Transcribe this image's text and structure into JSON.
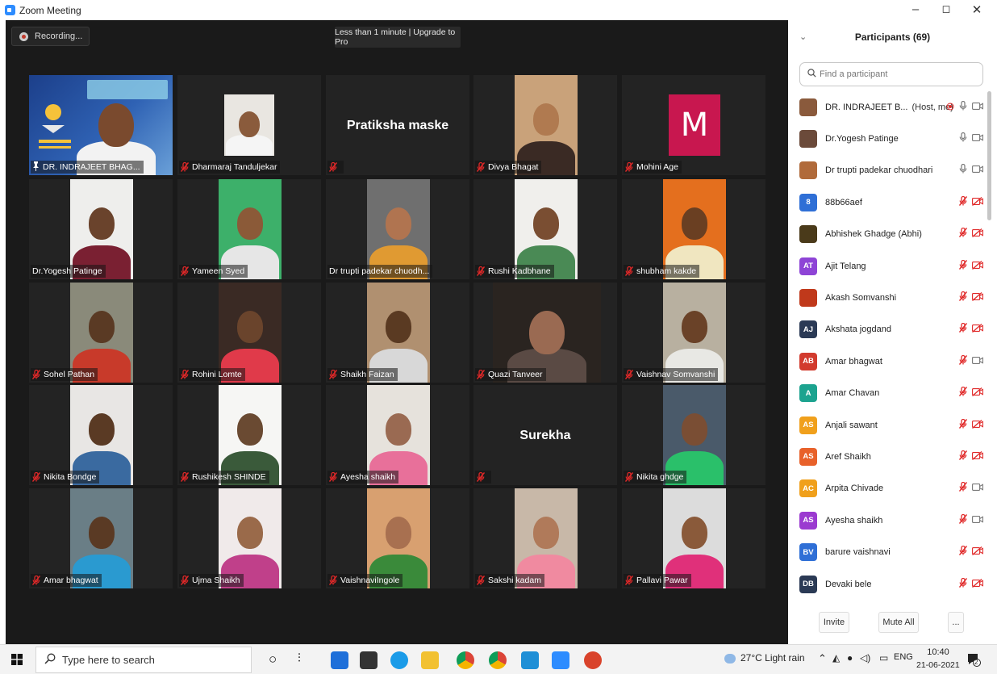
{
  "window": {
    "title": "Zoom Meeting",
    "controls": [
      "–",
      "◻",
      "✕"
    ]
  },
  "meeting": {
    "recording_label": "Recording...",
    "timer_label": "Less than 1 minute | Upgrade to Pro",
    "tiles": [
      {
        "name": "DR. INDRAJEET BHAG...",
        "kind": "video",
        "pinned": true,
        "active": true
      },
      {
        "name": "Dharmaraj Tanduljekar",
        "kind": "video",
        "muted": true
      },
      {
        "name": "",
        "kind": "text",
        "display": "Pratiksha maske",
        "muted": true
      },
      {
        "name": "Divya Bhagat",
        "kind": "video",
        "muted": true
      },
      {
        "name": "Mohini Age",
        "kind": "avatar",
        "letter": "M",
        "muted": true
      },
      {
        "name": "Dr.Yogesh Patinge",
        "kind": "video",
        "muted": false
      },
      {
        "name": "Yameen Syed",
        "kind": "video",
        "muted": true
      },
      {
        "name": "Dr trupti padekar chuodh...",
        "kind": "video",
        "muted": false
      },
      {
        "name": "Rushi Kadbhane",
        "kind": "video",
        "muted": true
      },
      {
        "name": "shubham kakde",
        "kind": "video",
        "muted": true
      },
      {
        "name": "Sohel Pathan",
        "kind": "video",
        "muted": true
      },
      {
        "name": "Rohini Lomte",
        "kind": "video",
        "muted": true
      },
      {
        "name": "Shaikh Faizan",
        "kind": "video",
        "muted": true
      },
      {
        "name": "Quazi Tanveer",
        "kind": "video",
        "muted": true
      },
      {
        "name": "Vaishnav Somvanshi",
        "kind": "video",
        "muted": true
      },
      {
        "name": "Nikita Bondge",
        "kind": "video",
        "muted": true
      },
      {
        "name": "Rushikesh SHINDE",
        "kind": "video",
        "muted": true
      },
      {
        "name": "Ayesha shaikh",
        "kind": "video",
        "muted": true
      },
      {
        "name": "",
        "kind": "text",
        "display": "Surekha",
        "muted": true
      },
      {
        "name": "Nikita ghdge",
        "kind": "video",
        "muted": true
      },
      {
        "name": "Amar bhagwat",
        "kind": "video",
        "muted": true
      },
      {
        "name": "Ujma Shaikh",
        "kind": "video",
        "muted": true
      },
      {
        "name": "VaishnaviIngole",
        "kind": "video",
        "muted": true
      },
      {
        "name": "Sakshi kadam",
        "kind": "video",
        "muted": true
      },
      {
        "name": "Pallavi Pawar",
        "kind": "video",
        "muted": true
      }
    ]
  },
  "participants": {
    "title": "Participants (69)",
    "search_placeholder": "Find a participant",
    "items": [
      {
        "initials": "",
        "name": "DR. INDRAJEET B...",
        "meta": "(Host, me)",
        "color": "#8a5a3c",
        "mic": "on",
        "video": "on",
        "rec": true
      },
      {
        "initials": "",
        "name": "Dr.Yogesh Patinge",
        "meta": "",
        "color": "#6b4a3a",
        "mic": "on",
        "video": "on"
      },
      {
        "initials": "",
        "name": "Dr trupti padekar chuodhari",
        "meta": "",
        "color": "#b06a3a",
        "mic": "on",
        "video": "on"
      },
      {
        "initials": "8",
        "name": "88b66aef",
        "meta": "",
        "color": "#2f6fd6",
        "mic": "off",
        "video": "off"
      },
      {
        "initials": "",
        "name": "Abhishek Ghadge (Abhi)",
        "meta": "",
        "color": "#4a3a1a",
        "mic": "off",
        "video": "off"
      },
      {
        "initials": "AT",
        "name": "Ajit Telang",
        "meta": "",
        "color": "#8e44d6",
        "mic": "off",
        "video": "off"
      },
      {
        "initials": "",
        "name": "Akash Somvanshi",
        "meta": "",
        "color": "#c0391b",
        "mic": "off",
        "video": "off"
      },
      {
        "initials": "AJ",
        "name": "Akshata jogdand",
        "meta": "",
        "color": "#2b3a55",
        "mic": "off",
        "video": "off"
      },
      {
        "initials": "AB",
        "name": "Amar bhagwat",
        "meta": "",
        "color": "#d23b2e",
        "mic": "off",
        "video": "on"
      },
      {
        "initials": "A",
        "name": "Amar Chavan",
        "meta": "",
        "color": "#1ca38f",
        "mic": "off",
        "video": "off"
      },
      {
        "initials": "AS",
        "name": "Anjali sawant",
        "meta": "",
        "color": "#f0a01c",
        "mic": "off",
        "video": "off"
      },
      {
        "initials": "AS",
        "name": "Aref Shaikh",
        "meta": "",
        "color": "#e8612a",
        "mic": "off",
        "video": "off"
      },
      {
        "initials": "AC",
        "name": "Arpita Chivade",
        "meta": "",
        "color": "#f0a01c",
        "mic": "off",
        "video": "on"
      },
      {
        "initials": "AS",
        "name": "Ayesha shaikh",
        "meta": "",
        "color": "#9b3ad0",
        "mic": "off",
        "video": "on"
      },
      {
        "initials": "BV",
        "name": "barure vaishnavi",
        "meta": "",
        "color": "#2f6fd6",
        "mic": "off",
        "video": "off"
      },
      {
        "initials": "DB",
        "name": "Devaki bele",
        "meta": "",
        "color": "#2b3a55",
        "mic": "off",
        "video": "off"
      }
    ],
    "invite_label": "Invite",
    "mute_all_label": "Mute All",
    "more_label": "..."
  },
  "taskbar": {
    "search_placeholder": "Type here to search",
    "weather": "27°C  Light rain",
    "lang": "ENG",
    "time": "10:40",
    "date": "21-06-2021",
    "notif_count": "2"
  },
  "colors": {
    "accent": "#2d8cff",
    "muted_red": "#e02828",
    "active_border": "#d6e34c"
  }
}
